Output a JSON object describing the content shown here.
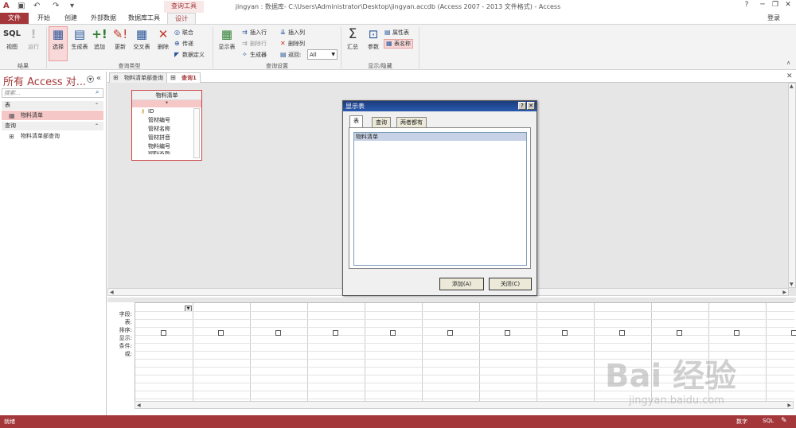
{
  "window": {
    "title": "jingyan : 数据库- C:\\Users\\Administrator\\Desktop\\jingyan.accdb (Access 2007 - 2013 文件格式) - Access",
    "context_tools": "查询工具",
    "login": "登录",
    "buttons": {
      "help": "?",
      "minimize": "─",
      "restore": "❐",
      "close": "✕"
    }
  },
  "ribbon_tabs": [
    "文件",
    "开始",
    "创建",
    "外部数据",
    "数据库工具",
    "设计"
  ],
  "ribbon": {
    "results": {
      "view": "视图",
      "view_caption": "SQL",
      "run": "运行",
      "group": "结果"
    },
    "query_type": {
      "group": "查询类型",
      "select": "选择",
      "make_table": "生成表",
      "append": "追加",
      "update": "更新",
      "crosstab": "交叉表",
      "delete": "删除",
      "union": "联合",
      "pass_through": "传递",
      "data_definition": "数据定义"
    },
    "query_setup": {
      "group": "查询设置",
      "show_table": "显示表",
      "insert_rows": "插入行",
      "delete_rows": "删除行",
      "builder": "生成器",
      "insert_columns": "插入列",
      "delete_columns": "删除列",
      "return": "返回:",
      "return_value": "All"
    },
    "show_hide": {
      "group": "显示/隐藏",
      "totals": "汇总",
      "parameters": "参数",
      "property_sheet": "属性表",
      "table_names": "表名称"
    }
  },
  "nav": {
    "header": "所有 Access 对...",
    "search_placeholder": "搜索...",
    "sections": [
      {
        "label": "表",
        "items": [
          "物料清单"
        ]
      },
      {
        "label": "查询",
        "items": [
          "物料清单部查询"
        ]
      }
    ]
  },
  "doc_tabs": [
    "物料清单部查询",
    "查询1"
  ],
  "table_box": {
    "title": "物料清单",
    "star": "*",
    "fields": [
      "ID",
      "管材编号",
      "管材名称",
      "管材拼音",
      "物料编号",
      "物料名称"
    ]
  },
  "dialog": {
    "title": "显示表",
    "help": "?",
    "close": "✕",
    "tabs": [
      "表",
      "查询",
      "两者都有"
    ],
    "items": [
      "物料清单"
    ],
    "add": "添加(A)",
    "close_btn": "关闭(C)"
  },
  "qbe": {
    "row_labels": [
      "字段:",
      "表:",
      "排序:",
      "显示:",
      "条件:",
      "或:"
    ]
  },
  "status": {
    "left": "就绪",
    "num_lock": "数字",
    "sql_view": "SQL"
  },
  "watermark": {
    "brand": "Bai  经验",
    "url": "jingyan.baidu.com"
  },
  "colors": {
    "accent": "#a4373a",
    "ribbon": "#f3f3f3",
    "selected": "#f8d8d8",
    "dialog_title": "#1c3c7c"
  }
}
